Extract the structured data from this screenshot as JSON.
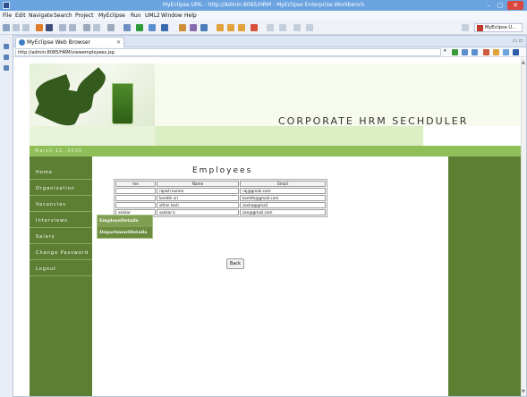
{
  "window": {
    "title": "MyEclipse UML - http://Admin:8085/HRM - MyEclipse Enterprise Workbench",
    "minimize": "–",
    "maximize": "▢",
    "close": "✕"
  },
  "menu": [
    "File",
    "Edit",
    "Navigate",
    "Search",
    "Project",
    "MyEclipse",
    "Run",
    "UML2",
    "Window",
    "Help"
  ],
  "toolbar": {
    "perspective_label": "MyEclipse U..."
  },
  "editor": {
    "tab_label": "MyEclipse Web Browser",
    "tab_close": "✕",
    "view_controls": "▭ ▫",
    "url": "http://admin:8085/HRM/viewemployees.jsp",
    "url_dropdown": "▾"
  },
  "page": {
    "header_title": "CORPORATE HRM SECHDULER",
    "date": "March 11, 2020",
    "nav": [
      "Home",
      "Organization",
      "Vacancies",
      "Interviews",
      "Salary",
      "Change Password",
      "Logout"
    ],
    "flyout": [
      "EmployeDetails",
      "DepartmentDetails"
    ],
    "content_title": "Employees",
    "table": {
      "headers": [
        "me",
        "Name",
        "Email"
      ],
      "rows": [
        [
          "",
          "rajesh kumar",
          "raj@gmail.com"
        ],
        [
          "",
          "komthi sri",
          "komthi@gmail.com"
        ],
        [
          "",
          "sithin tech",
          "sasha@gmail"
        ],
        [
          "sankar",
          "sankar k",
          "san@gmail.com"
        ]
      ]
    },
    "back_label": "Back"
  },
  "colors": {
    "nav_green": "#5d7f34",
    "date_bar": "#8fbf58",
    "titlebar": "#6aa3e0",
    "close_red": "#d9463c"
  }
}
